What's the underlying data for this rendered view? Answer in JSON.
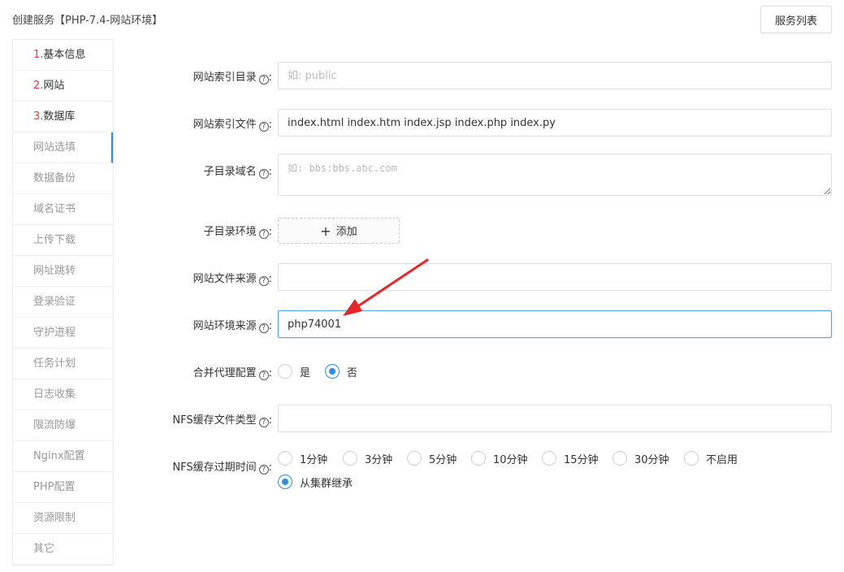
{
  "header": {
    "title": "创建服务【PHP-7.4-网站环境】",
    "service_list_label": "服务列表"
  },
  "sidebar": {
    "items": [
      {
        "num": "1.",
        "label": "基本信息"
      },
      {
        "num": "2.",
        "label": "网站"
      },
      {
        "num": "3.",
        "label": "数据库"
      },
      {
        "num": "",
        "label": "网站选填"
      },
      {
        "num": "",
        "label": "数据备份"
      },
      {
        "num": "",
        "label": "域名证书"
      },
      {
        "num": "",
        "label": "上传下载"
      },
      {
        "num": "",
        "label": "网址跳转"
      },
      {
        "num": "",
        "label": "登录验证"
      },
      {
        "num": "",
        "label": "守护进程"
      },
      {
        "num": "",
        "label": "任务计划"
      },
      {
        "num": "",
        "label": "日志收集"
      },
      {
        "num": "",
        "label": "限流防爆"
      },
      {
        "num": "",
        "label": "Nginx配置"
      },
      {
        "num": "",
        "label": "PHP配置"
      },
      {
        "num": "",
        "label": "资源限制"
      },
      {
        "num": "",
        "label": "其它"
      }
    ]
  },
  "form": {
    "index_dir": {
      "label": "网站索引目录",
      "value": "",
      "placeholder": "如: public"
    },
    "index_file": {
      "label": "网站索引文件",
      "value": "index.html index.htm index.jsp index.php index.py"
    },
    "subdir_domain": {
      "label": "子目录域名",
      "placeholder": "如: bbs:bbs.abc.com"
    },
    "subdir_env": {
      "label": "子目录环境",
      "add_label": "添加"
    },
    "file_source": {
      "label": "网站文件来源",
      "value": ""
    },
    "env_source": {
      "label": "网站环境来源",
      "value": "php74001"
    },
    "merge_proxy": {
      "label": "合并代理配置",
      "options": [
        "是",
        "否"
      ],
      "selected": "否"
    },
    "nfs_file_type": {
      "label": "NFS缓存文件类型",
      "value": ""
    },
    "nfs_expire": {
      "label": "NFS缓存过期时间",
      "options": [
        "1分钟",
        "3分钟",
        "5分钟",
        "10分钟",
        "15分钟",
        "30分钟",
        "不启用",
        "从集群继承"
      ],
      "selected": "从集群继承"
    }
  },
  "colors": {
    "accent": "#2d8cf0",
    "step_number": "#e4393c",
    "arrow": "#e8262a"
  },
  "icons": {
    "help": "question-circle-icon",
    "add": "plus-icon"
  }
}
